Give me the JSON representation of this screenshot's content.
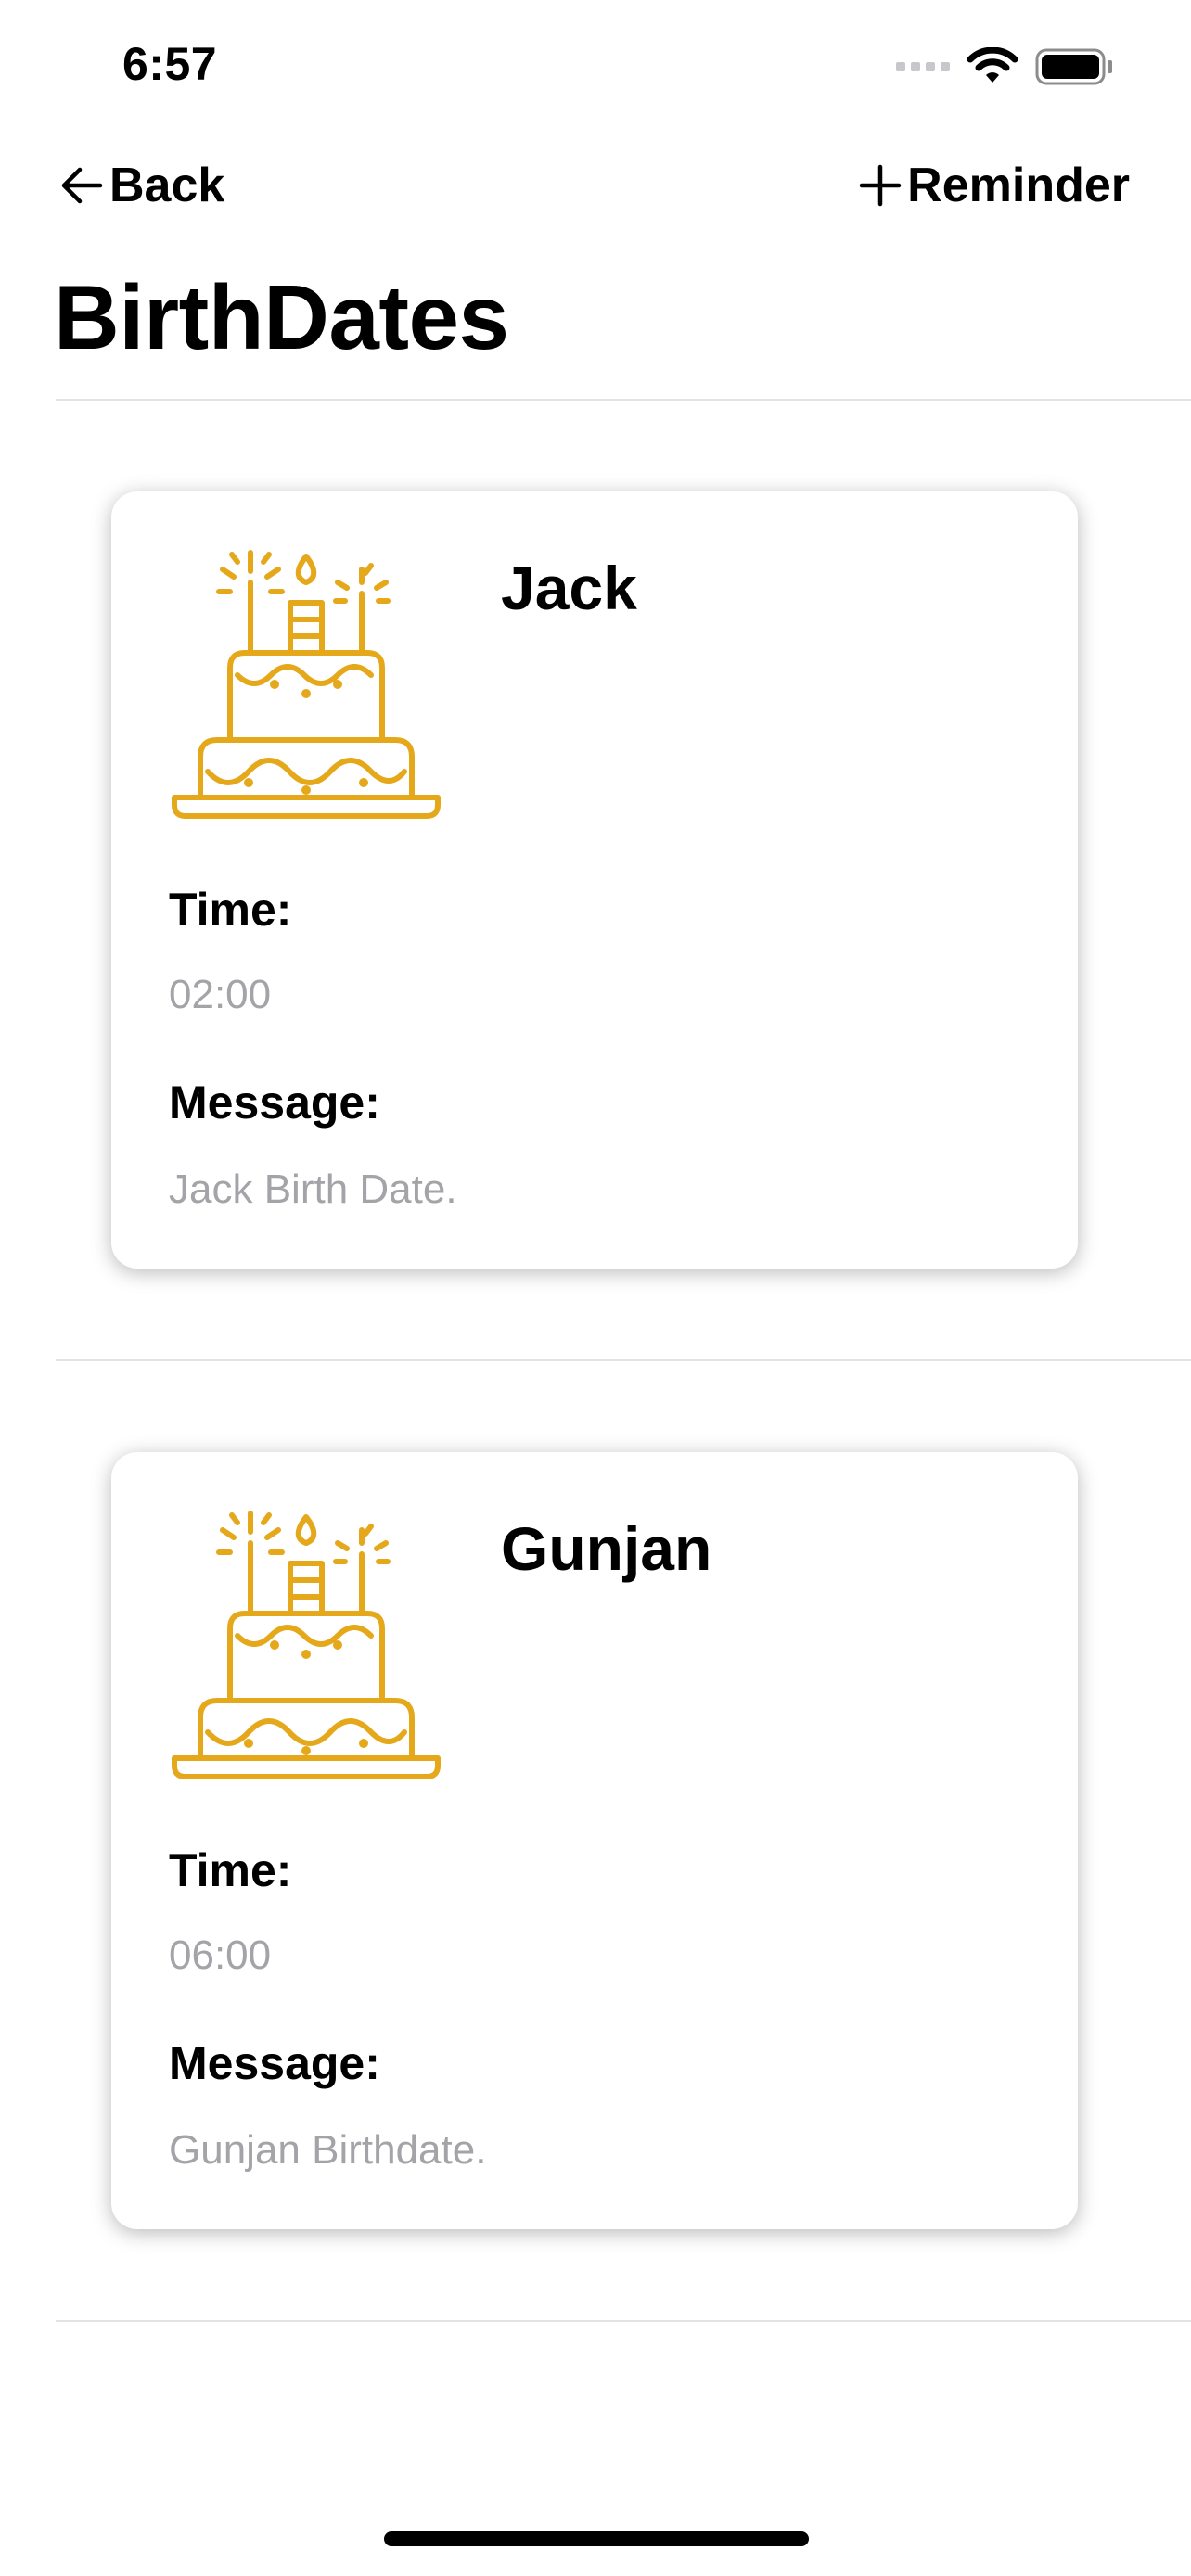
{
  "status_bar": {
    "time": "6:57"
  },
  "nav": {
    "back_label": "Back",
    "add_label": "Reminder"
  },
  "page": {
    "title": "BirthDates"
  },
  "reminders": [
    {
      "name": "Jack",
      "time_label": "Time:",
      "time": "02:00",
      "message_label": "Message:",
      "message": "Jack Birth Date."
    },
    {
      "name": "Gunjan",
      "time_label": "Time:",
      "time": "06:00",
      "message_label": "Message:",
      "message": "Gunjan Birthdate."
    }
  ],
  "icons": {
    "back": "arrow-left-icon",
    "add": "plus-icon",
    "cake": "birthday-cake-icon",
    "wifi": "wifi-icon",
    "battery": "battery-icon",
    "signal": "cellular-signal-icon"
  },
  "colors": {
    "accent": "#E5A81A",
    "secondary_text": "#A3A3A8",
    "divider": "#E3E3E6"
  }
}
